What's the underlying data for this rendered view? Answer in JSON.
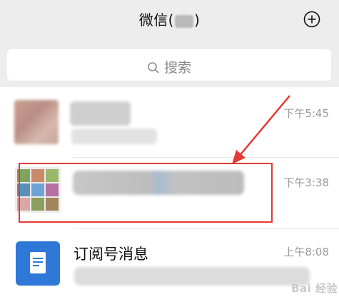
{
  "header": {
    "title_prefix": "微信(",
    "title_suffix": ")",
    "add_icon": "plus-circle-icon"
  },
  "search": {
    "icon": "search-icon",
    "placeholder": "搜索"
  },
  "chats": [
    {
      "time": "下午5:45"
    },
    {
      "time": "下午3:38"
    },
    {
      "title": "订阅号消息",
      "time": "上午8:08",
      "icon": "document-icon"
    }
  ],
  "watermark": "Bai 经验",
  "colors": {
    "highlight": "#e53935",
    "doc_avatar": "#2e78d8",
    "header_bg": "#ededed"
  }
}
